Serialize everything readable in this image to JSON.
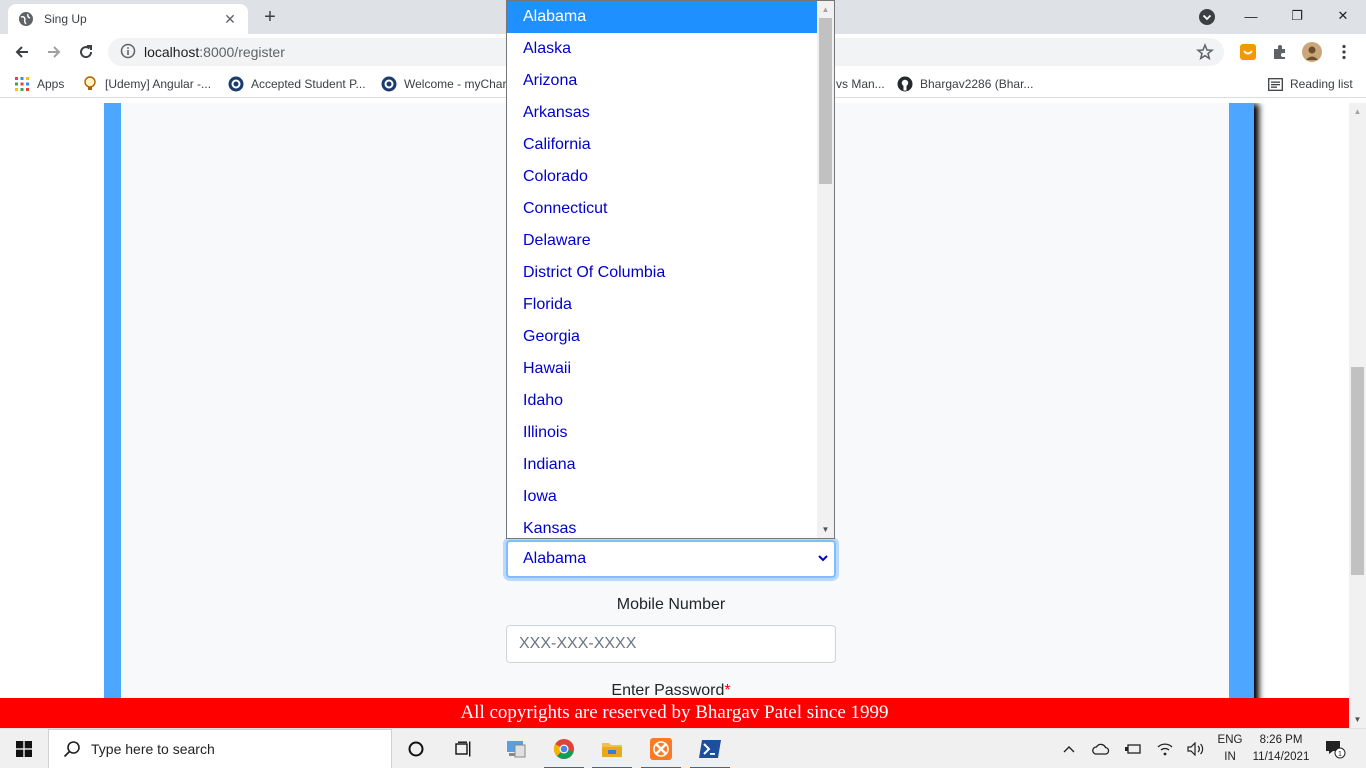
{
  "browser": {
    "tab": {
      "title": "Sing Up",
      "close": "✕"
    },
    "new_tab": "+",
    "window": {
      "minimize": "—",
      "restore": "❐",
      "close": "✕"
    },
    "address": {
      "host": "localhost",
      "rest": ":8000/register"
    },
    "bookmarks": {
      "apps": "Apps",
      "items": [
        "[Udemy] Angular -...",
        "Accepted Student P...",
        "Welcome - myChar",
        "vs Man...",
        "Bhargav2286 (Bhar..."
      ],
      "reading_list": "Reading list"
    }
  },
  "form": {
    "state_select": {
      "value": "Alabama"
    },
    "mobile": {
      "label": "Mobile Number",
      "placeholder": "XXX-XXX-XXXX"
    },
    "password": {
      "label": "Enter Password",
      "required_mark": "*"
    }
  },
  "state_dropdown": {
    "selected": "Alabama",
    "options": [
      "Alabama",
      "Alaska",
      "Arizona",
      "Arkansas",
      "California",
      "Colorado",
      "Connecticut",
      "Delaware",
      "District Of Columbia",
      "Florida",
      "Georgia",
      "Hawaii",
      "Idaho",
      "Illinois",
      "Indiana",
      "Iowa",
      "Kansas"
    ]
  },
  "footer": {
    "text": "All copyrights are reserved by Bhargav Patel since 1999"
  },
  "taskbar": {
    "search_placeholder": "Type here to search",
    "language": {
      "line1": "ENG",
      "line2": "IN"
    },
    "clock": {
      "time": "8:26 PM",
      "date": "11/14/2021"
    },
    "notification_count": "1"
  },
  "colors": {
    "page_border": "#4da6ff",
    "footer_bg": "#ff0000",
    "option_text": "#0000cc",
    "option_highlight": "#1e90ff"
  }
}
